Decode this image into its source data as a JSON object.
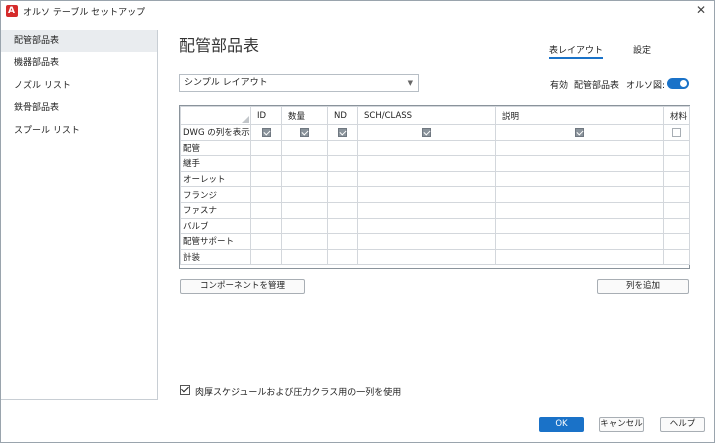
{
  "window": {
    "title": "オルソ テーブル セットアップ",
    "close": "✕",
    "app_icon_letter": "A"
  },
  "sidebar": {
    "items": [
      {
        "label": "配管部品表",
        "active": true
      },
      {
        "label": "機器部品表",
        "active": false
      },
      {
        "label": "ノズル リスト",
        "active": false
      },
      {
        "label": "鉄骨部品表",
        "active": false
      },
      {
        "label": "スプール リスト",
        "active": false
      }
    ]
  },
  "main": {
    "title": "配管部品表",
    "tabs": [
      {
        "label": "表レイアウト",
        "active": true
      },
      {
        "label": "設定",
        "active": false
      }
    ],
    "layout_select": {
      "value": "シンプル レイアウト"
    },
    "status": {
      "enabled_label": "有効",
      "table_name": "配管部品表",
      "ortho_label": "オルソ図:",
      "ortho_on": true
    }
  },
  "grid": {
    "columns": [
      "ID",
      "数量",
      "ND",
      "SCH/CLASS",
      "説明",
      "材料"
    ],
    "show_row_label": "DWG の列を表示",
    "show_row_values": [
      true,
      true,
      true,
      true,
      true,
      false
    ],
    "rows": [
      "配管",
      "継手",
      "オーレット",
      "フランジ",
      "ファスナ",
      "バルブ",
      "配管サポート",
      "計装"
    ]
  },
  "buttons": {
    "manage_components": "コンポーネントを管理",
    "add_column": "列を追加",
    "ok": "OK",
    "cancel": "キャンセル",
    "help": "ヘルプ"
  },
  "option": {
    "label": "肉厚スケジュールおよび圧力クラス用の一列を使用",
    "checked": true
  },
  "colors": {
    "accent": "#1a72c8",
    "app_icon": "#d52b2b"
  }
}
